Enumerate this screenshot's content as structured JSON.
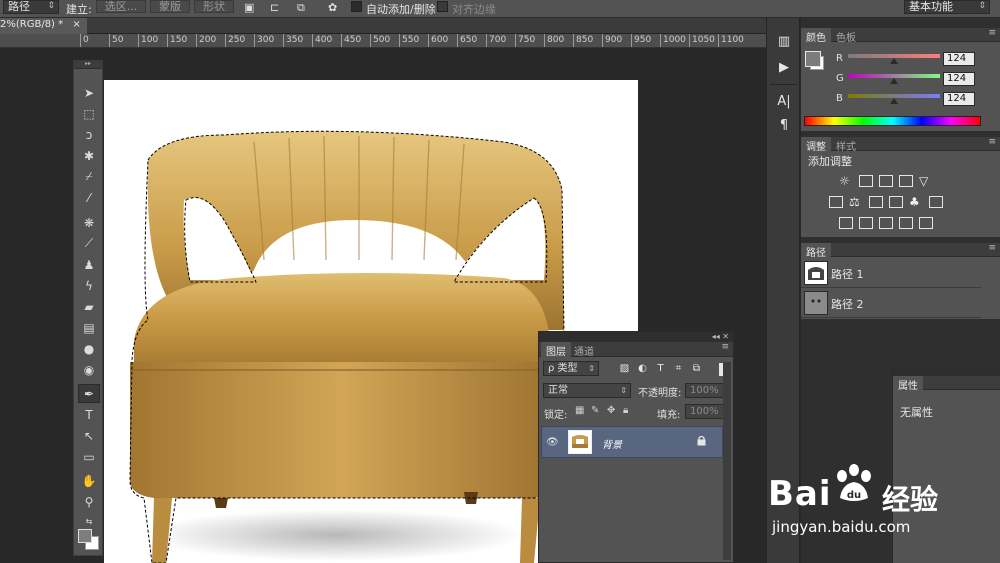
{
  "options_bar": {
    "tool_mode": "路径",
    "make_label": "建立:",
    "selection_btn": "选区...",
    "mask_btn": "蒙版",
    "shape_btn": "形状",
    "auto_add_delete": "自动添加/删除",
    "align_edges": "对齐边缘",
    "workspace": "基本功能"
  },
  "document": {
    "tab_title": "2%(RGB/8) *",
    "ruler_ticks": [
      "0",
      "50",
      "100",
      "150",
      "200",
      "250",
      "300",
      "350",
      "400",
      "450",
      "500",
      "550",
      "600",
      "650",
      "700",
      "750",
      "800",
      "850",
      "900",
      "950",
      "1000",
      "1050",
      "1100"
    ]
  },
  "color_panel": {
    "tabs": [
      "颜色",
      "色板"
    ],
    "r_label": "R",
    "g_label": "G",
    "b_label": "B",
    "r_value": "124",
    "g_value": "124",
    "b_value": "124",
    "foreground_color": "#7c7c7c"
  },
  "adjustments_panel": {
    "tabs": [
      "调整",
      "样式"
    ],
    "add_label": "添加调整"
  },
  "paths_panel": {
    "tab": "路径",
    "items": [
      {
        "name": "路径 1"
      },
      {
        "name": "路径 2"
      }
    ]
  },
  "layers_panel": {
    "tabs": [
      "图层",
      "通道"
    ],
    "filter_kind": "ρ 类型",
    "blend_mode": "正常",
    "opacity_label": "不透明度:",
    "opacity_value": "100%",
    "lock_label": "锁定:",
    "fill_label": "填充:",
    "fill_value": "100%",
    "layer": {
      "name": "背景"
    }
  },
  "properties_panel": {
    "tab": "属性",
    "body": "无属性"
  },
  "watermark": {
    "brand": "Bai",
    "brand_tail": "du",
    "cn": "经验",
    "url": "jingyan.baidu.com"
  },
  "colors": {
    "selected_layer": "#596680",
    "chair_gold": "#c89b48",
    "panel_bg": "#535353"
  }
}
